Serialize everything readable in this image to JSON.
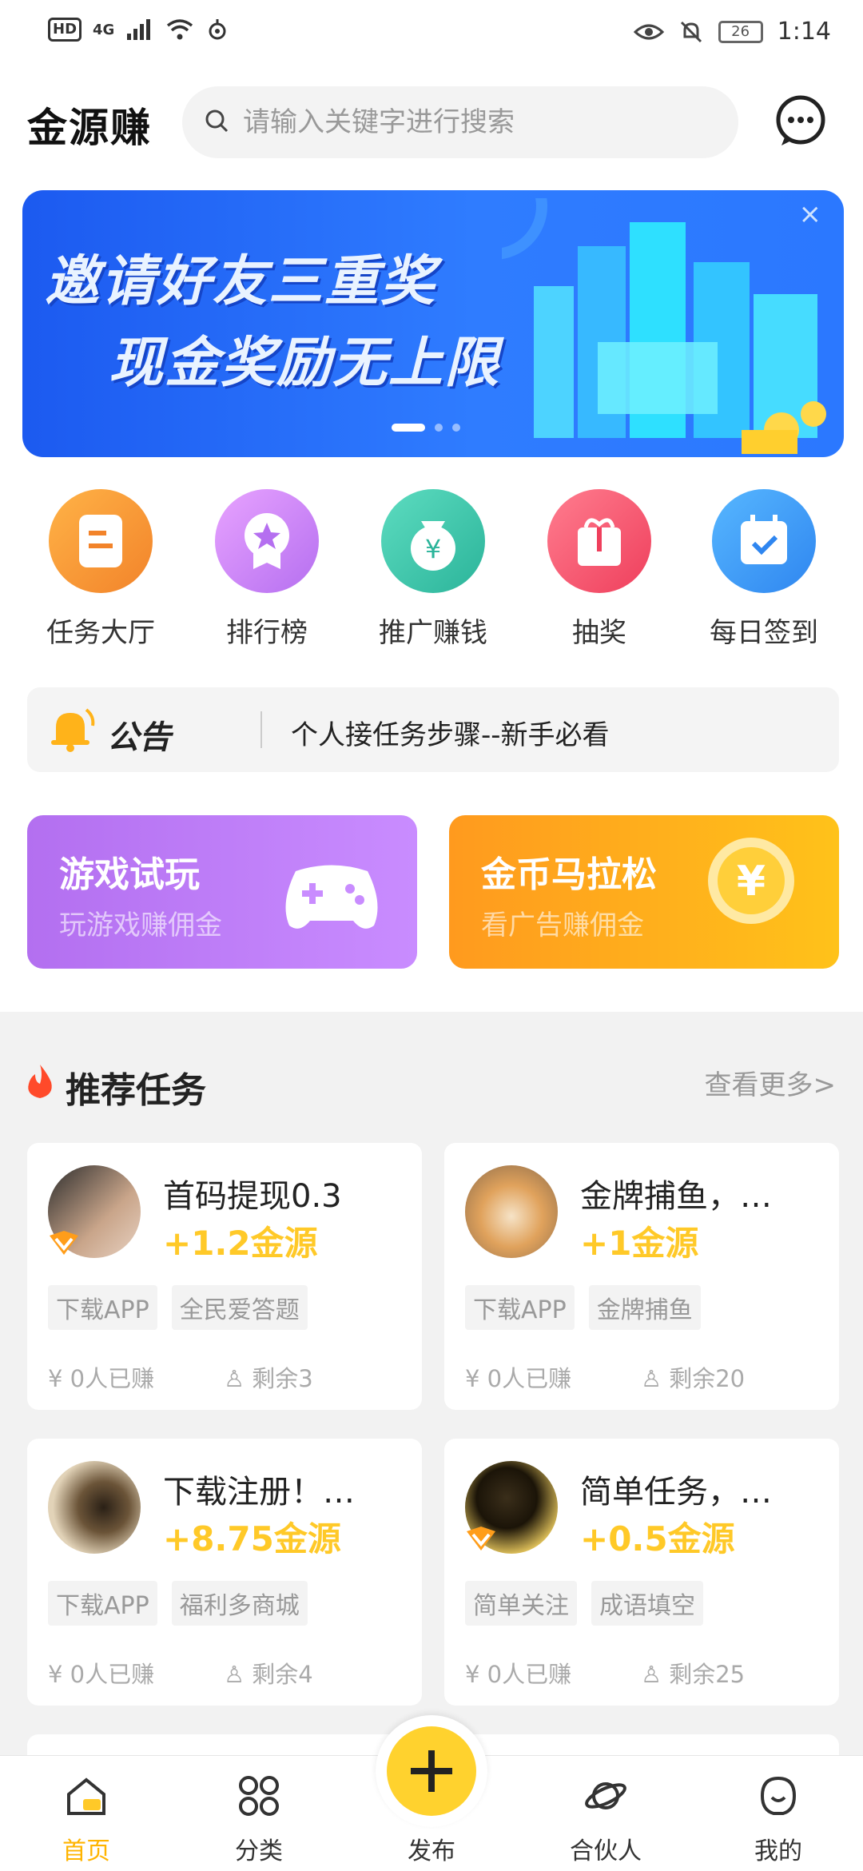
{
  "status": {
    "time": "1:14",
    "battery": "26",
    "network": "4G"
  },
  "header": {
    "logo": "金源赚",
    "search_placeholder": "请输入关键字进行搜索"
  },
  "banner": {
    "line1": "邀请好友三重奖",
    "line2": "现金奖励无上限",
    "close": "×"
  },
  "quick": [
    {
      "label": "任务大厅",
      "color": "#f89b2e"
    },
    {
      "label": "排行榜",
      "color": "#c77ef2"
    },
    {
      "label": "推广赚钱",
      "color": "#38c4a6"
    },
    {
      "label": "抽奖",
      "color": "#f4536e"
    },
    {
      "label": "每日签到",
      "color": "#2f96f0"
    }
  ],
  "notice": {
    "tag": "公告",
    "text": "个人接任务步骤--新手必看"
  },
  "promo": [
    {
      "title": "游戏试玩",
      "subtitle": "玩游戏赚佣金"
    },
    {
      "title": "金币马拉松",
      "subtitle": "看广告赚佣金"
    }
  ],
  "recommend": {
    "title": "推荐任务",
    "more": "查看更多>",
    "cards": [
      {
        "title": "首码提现0.3",
        "reward": "+1.2金源",
        "tags": [
          "下载APP",
          "全民爱答题"
        ],
        "earned": "0人已赚",
        "left": "剩余3"
      },
      {
        "title": "金牌捕鱼，…",
        "reward": "+1金源",
        "tags": [
          "下载APP",
          "金牌捕鱼"
        ],
        "earned": "0人已赚",
        "left": "剩余20"
      },
      {
        "title": "下载注册！…",
        "reward": "+8.75金源",
        "tags": [
          "下载APP",
          "福利多商城"
        ],
        "earned": "0人已赚",
        "left": "剩余4"
      },
      {
        "title": "简单任务，…",
        "reward": "+0.5金源",
        "tags": [
          "简单关注",
          "成语填空"
        ],
        "earned": "0人已赚",
        "left": "剩余25"
      }
    ]
  },
  "nav": {
    "home": "首页",
    "category": "分类",
    "publish": "发布",
    "partner": "合伙人",
    "mine": "我的"
  },
  "colors": {
    "accent": "#ffc928",
    "nav_active": "#ffb400"
  }
}
